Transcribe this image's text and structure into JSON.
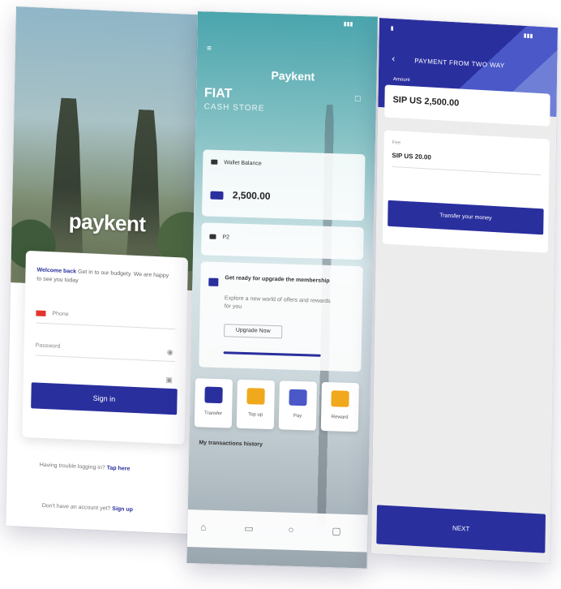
{
  "login": {
    "logo": "paykent",
    "welcome_bold": "Welcome back",
    "welcome_text": "Get in to our budgety. We are happy to see you today",
    "phone_placeholder": "Phone",
    "password_placeholder": "Password",
    "signin_label": "Sign in",
    "forgot_text": "Having trouble logging in?",
    "forgot_link": "Tap here",
    "signup_text": "Don't have an account yet?",
    "signup_link": "Sign up"
  },
  "dashboard": {
    "logo": "Paykent",
    "title": "FIAT",
    "subtitle": "CASH STORE",
    "wallet_label": "Wallet Balance",
    "balance": "2,500.00",
    "card2_label": "P2",
    "promo_title": "Get ready for upgrade the membership",
    "promo_text": "Explore a new world of offers and rewards for you",
    "promo_button": "Upgrade Now",
    "tiles": [
      {
        "label": "Transfer",
        "color": "#2a2f9e"
      },
      {
        "label": "Top up",
        "color": "#f0a81c"
      },
      {
        "label": "Pay",
        "color": "#4a58c8"
      },
      {
        "label": "Reward",
        "color": "#f0a81c"
      }
    ],
    "section_label": "My transactions history",
    "nav_icons": [
      "home-icon",
      "card-icon",
      "chat-icon",
      "profile-icon"
    ]
  },
  "transfer": {
    "title": "PAYMENT FROM TWO WAY",
    "amount": "SIP US 2,500.00",
    "amount_caption": "Amount",
    "fee_caption": "Fee",
    "fee_value": "SIP US 20.00",
    "action_button": "Transfer your money",
    "next_label": "NEXT"
  },
  "colors": {
    "brand": "#2a2f9e",
    "accent": "#f0a81c"
  }
}
